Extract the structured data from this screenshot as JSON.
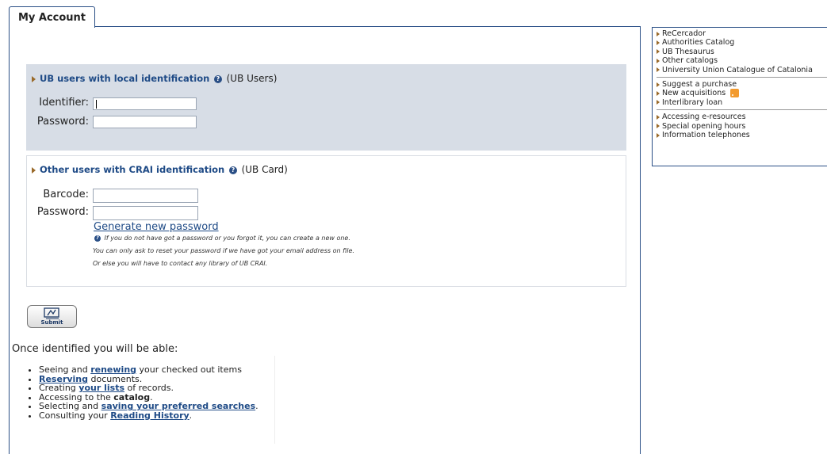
{
  "tab": {
    "label": "My Account"
  },
  "ub_users": {
    "title": "UB users with local identification",
    "suffix": "(UB Users)",
    "identifier_label": "Identifier:",
    "password_label": "Password:",
    "identifier_value": "",
    "password_value": ""
  },
  "other_users": {
    "title": "Other users with CRAI identification",
    "suffix": "(UB Card)",
    "barcode_label": "Barcode:",
    "password_label": "Password:",
    "generate_link": "Generate new password",
    "note1": "If you do not have got a password or you forgot it, you can create a new one.",
    "note2": "You can only ask to reset your password if we have got your email address on file.",
    "note3": "Or else you will have to contact any library of UB CRAI."
  },
  "submit": {
    "label": "Submit",
    "icon": "hand-writing-icon"
  },
  "benefits": {
    "intro": "Once identified you will be able:",
    "items": [
      {
        "pre": "Seeing and ",
        "link": "renewing",
        "post": " your checked out items"
      },
      {
        "pre": "",
        "link": "Reserving",
        "post": " documents."
      },
      {
        "pre": "Creating ",
        "link": "your lists",
        "post": " of records."
      },
      {
        "pre": "Accessing to the ",
        "link": "catalog",
        "post": "."
      },
      {
        "pre": "Selecting and ",
        "link": "saving your preferred searches",
        "post": "."
      },
      {
        "pre": "Consulting your ",
        "link": "Reading History",
        "post": "."
      }
    ]
  },
  "sidebar": {
    "group1": [
      "ReCercador",
      "Authorities Catalog",
      "UB Thesaurus",
      "Other catalogs",
      "University Union Catalogue of Catalonia"
    ],
    "group2": [
      "Suggest a purchase",
      "New acquisitions",
      "Interlibrary loan"
    ],
    "group3": [
      "Accessing e-resources",
      "Special opening hours",
      "Information telephones"
    ]
  },
  "colors": {
    "accent": "#1e4a86",
    "panel": "#d7dde6",
    "rss": "#f29a2e"
  }
}
